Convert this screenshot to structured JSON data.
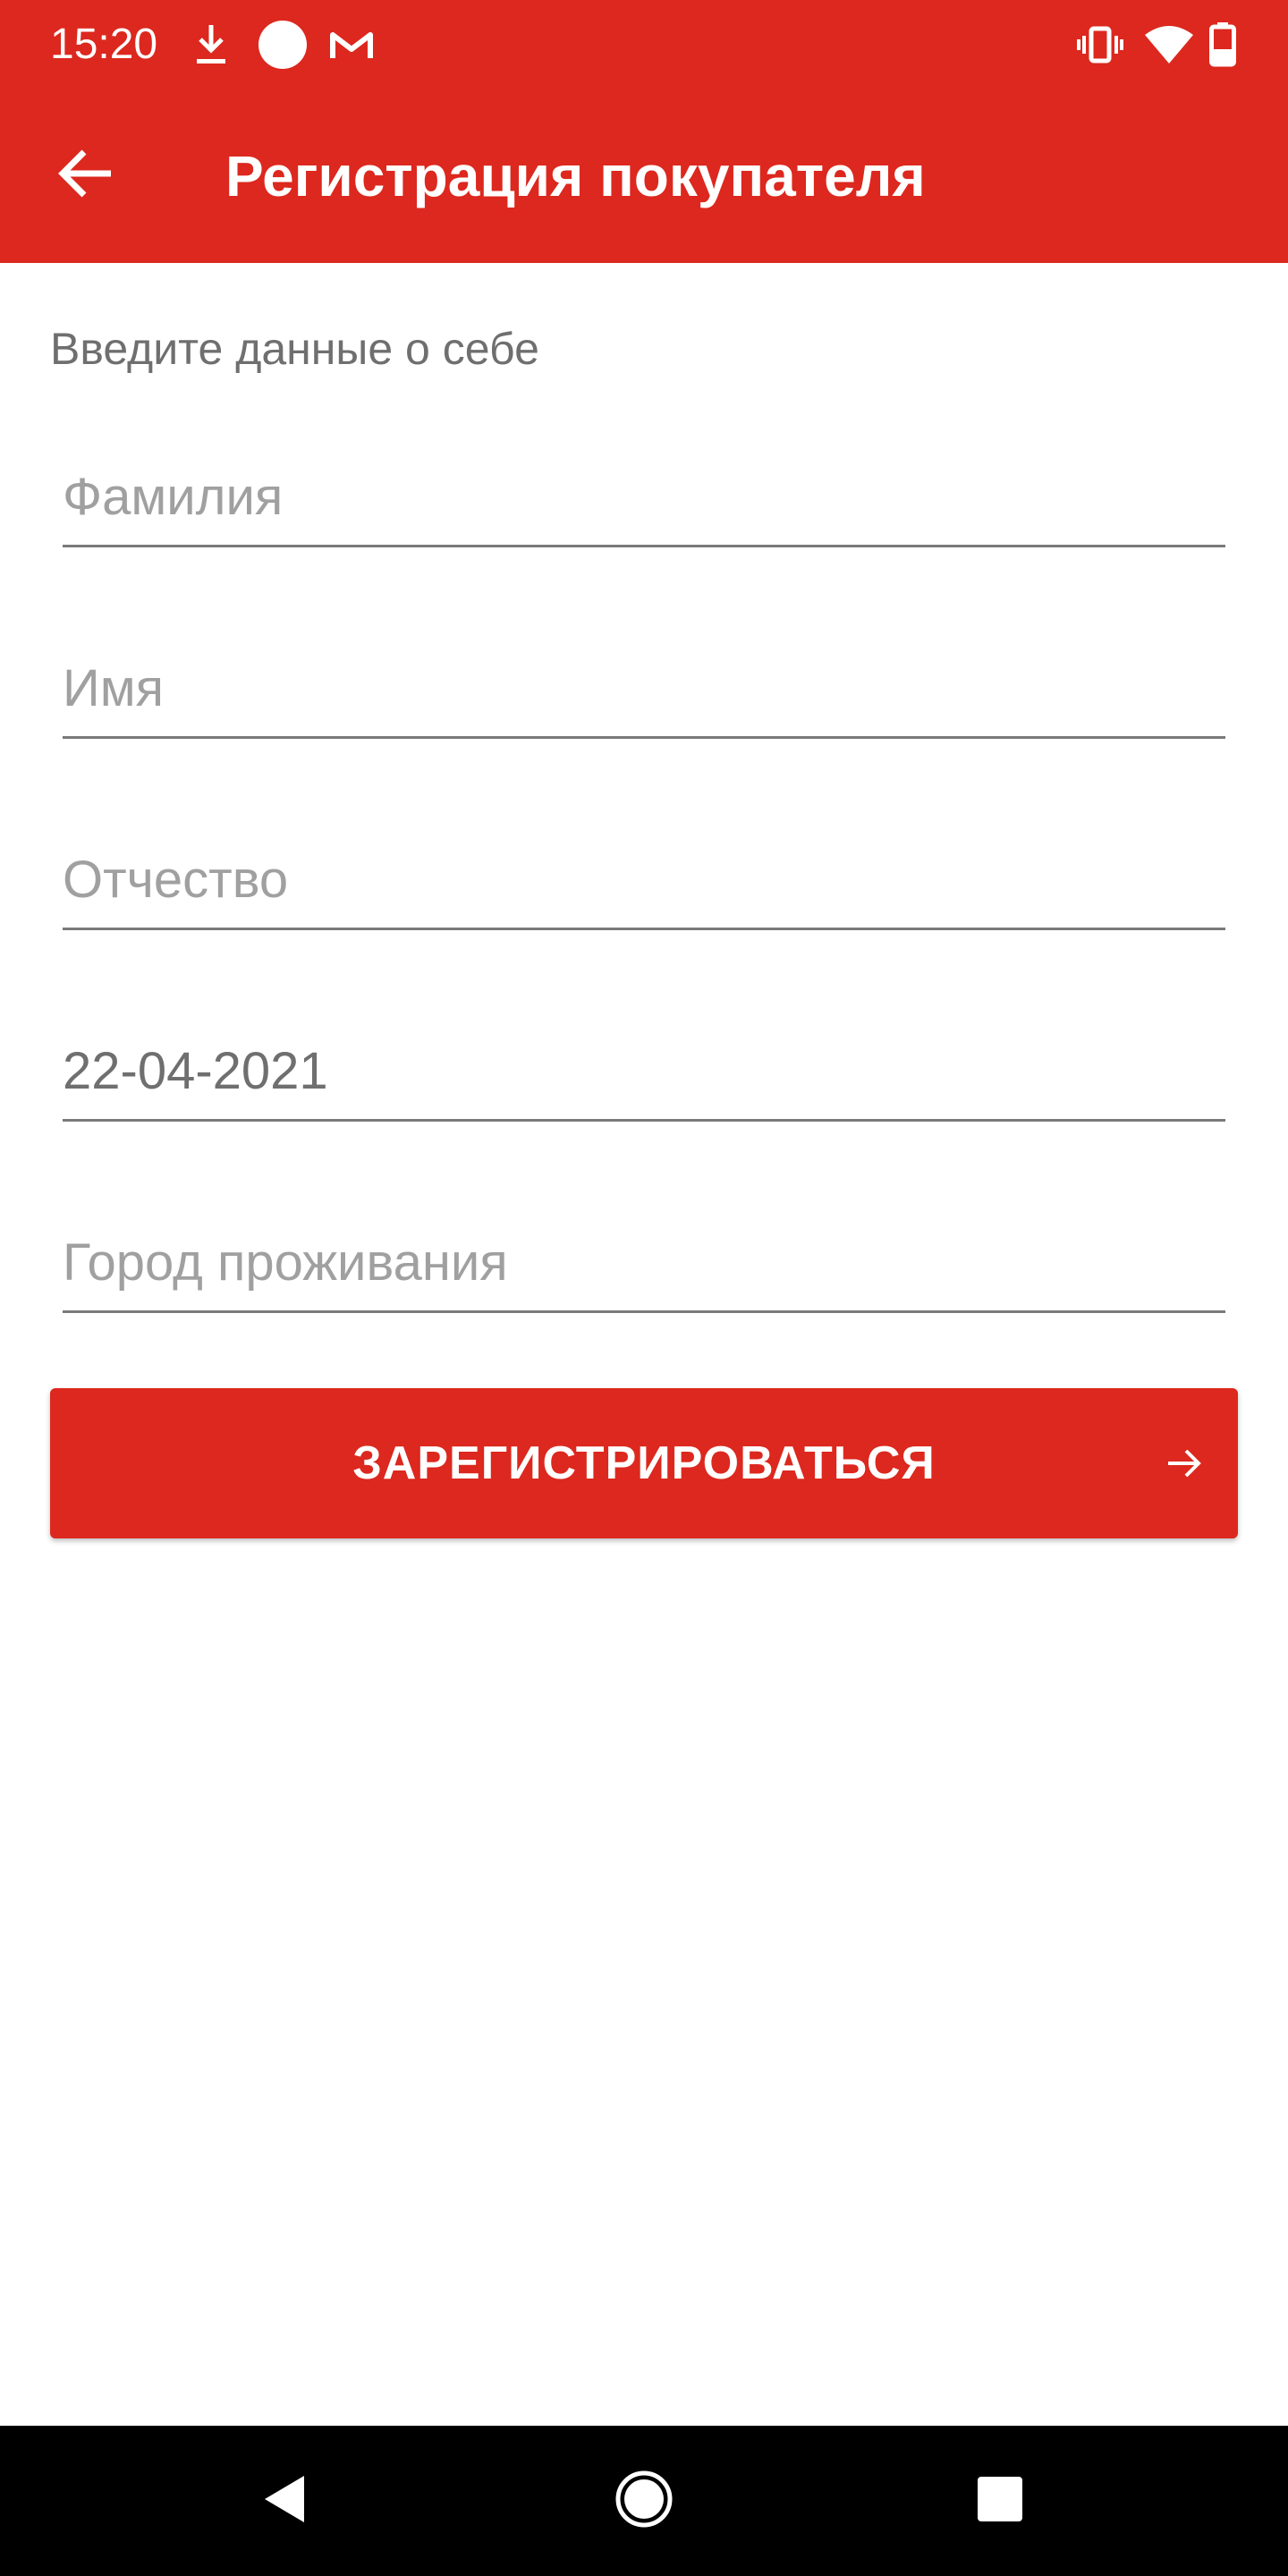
{
  "status_bar": {
    "time": "15:20",
    "left_icons": [
      "download-icon",
      "circle-icon",
      "gmail-icon"
    ],
    "right_icons": [
      "vibrate-icon",
      "wifi-icon",
      "battery-icon"
    ]
  },
  "app_bar": {
    "back_icon": "arrow-left-icon",
    "title": "Регистрация покупателя"
  },
  "form": {
    "intro": "Введите данные о себе",
    "fields": {
      "lastname": {
        "placeholder": "Фамилия",
        "value": ""
      },
      "firstname": {
        "placeholder": "Имя",
        "value": ""
      },
      "patronymic": {
        "placeholder": "Отчество",
        "value": ""
      },
      "birthdate": {
        "placeholder": "",
        "value": "22-04-2021"
      },
      "city": {
        "placeholder": "Город проживания",
        "value": ""
      }
    },
    "register_button": {
      "label": "ЗАРЕГИСТРИРОВАТЬСЯ",
      "icon": "arrow-right-icon"
    }
  },
  "nav_bar": {
    "buttons": [
      "back-triangle-icon",
      "home-circle-icon",
      "recents-square-icon"
    ]
  },
  "colors": {
    "primary": "#dc281e",
    "text_secondary": "#6f6f6f",
    "hint": "#a0a0a0",
    "nav_background": "#000000"
  }
}
